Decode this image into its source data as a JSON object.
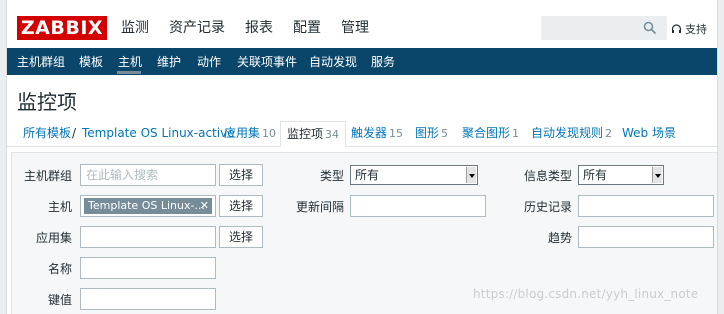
{
  "header": {
    "logo": "ZABBIX",
    "menu": [
      "监测",
      "资产记录",
      "报表",
      "配置",
      "管理"
    ],
    "search": {
      "value": "",
      "placeholder": ""
    },
    "support": "支持"
  },
  "subnav": {
    "items": [
      "主机群组",
      "模板",
      "主机",
      "维护",
      "动作",
      "关联项事件",
      "自动发现",
      "服务"
    ],
    "active": "主机"
  },
  "page": {
    "title": "监控项"
  },
  "breadcrumb": {
    "root": "所有模板",
    "separator": "/",
    "template": "Template OS Linux-active"
  },
  "tabs": [
    {
      "label": "应用集",
      "count": "10"
    },
    {
      "label": "监控项",
      "count": "34"
    },
    {
      "label": "触发器",
      "count": "15"
    },
    {
      "label": "图形",
      "count": "5"
    },
    {
      "label": "聚合图形",
      "count": "1"
    },
    {
      "label": "自动发现规则",
      "count": "2"
    },
    {
      "label": "Web 场景",
      "count": ""
    }
  ],
  "filter": {
    "host_group": {
      "label": "主机群组",
      "placeholder": "在此输入搜索",
      "button": "选择"
    },
    "host": {
      "label": "主机",
      "chip": "Template OS Linux-...",
      "button": "选择"
    },
    "application": {
      "label": "应用集",
      "value": "",
      "button": "选择"
    },
    "name": {
      "label": "名称",
      "value": ""
    },
    "key": {
      "label": "键值",
      "value": ""
    },
    "type": {
      "label": "类型",
      "value": "所有"
    },
    "update_interval": {
      "label": "更新间隔",
      "value": ""
    },
    "info_type": {
      "label": "信息类型",
      "value": "所有"
    },
    "history": {
      "label": "历史记录",
      "value": ""
    },
    "trends": {
      "label": "趋势",
      "value": ""
    }
  },
  "watermark": "https://blog.csdn.net/yyh_linux_note",
  "colors": {
    "brand": "#d40000",
    "nav": "#0a466a",
    "link": "#0275b8"
  }
}
